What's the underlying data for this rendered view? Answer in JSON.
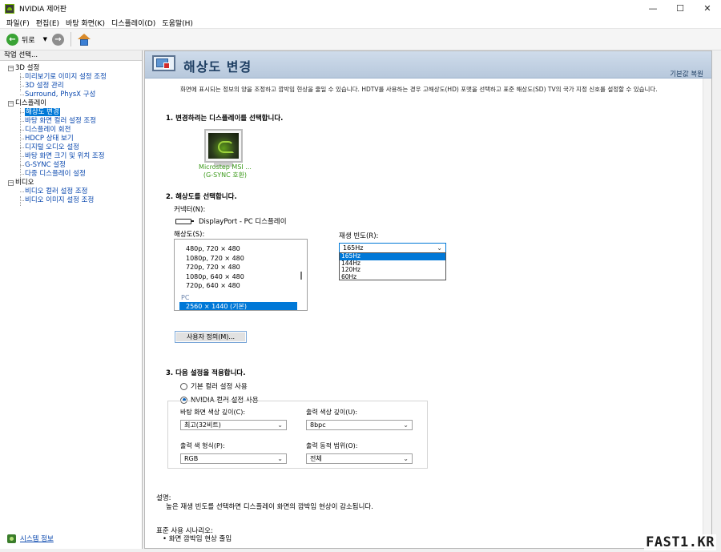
{
  "window": {
    "title": "NVIDIA 제어판",
    "controls": [
      "minimize",
      "maximize",
      "close"
    ]
  },
  "menu": [
    "파일(F)",
    "편집(E)",
    "바탕 화면(K)",
    "디스플레이(D)",
    "도움말(H)"
  ],
  "toolbar": {
    "back_label": "뒤로",
    "back_icon": "back-arrow-icon",
    "forward_icon": "forward-arrow-icon",
    "home_icon": "home-icon"
  },
  "sidebar": {
    "header": "작업 선택...",
    "categories": [
      {
        "label": "3D 설정",
        "items": [
          "미리보기로 이미지 설정 조정",
          "3D 설정 관리",
          "Surround, PhysX 구성"
        ]
      },
      {
        "label": "디스플레이",
        "items": [
          "해상도 변경",
          "바탕 화면 컬러 설정 조정",
          "디스플레이 회전",
          "HDCP 상태 보기",
          "디지털 오디오 설정",
          "바탕 화면 크기 및 위치 조정",
          "G-SYNC 설정",
          "다중 디스플레이 설정"
        ]
      },
      {
        "label": "비디오",
        "items": [
          "비디오 컬러 설정 조정",
          "비디오 이미지 설정 조정"
        ]
      }
    ],
    "selected_item": "해상도 변경",
    "system_info": "시스템 정보"
  },
  "main": {
    "title": "해상도 변경",
    "restore_defaults": "기본값 복원",
    "description": "화면에 표시되는 정보의 양을 조정하고 깜박임 현상을 줄일 수 있습니다. HDTV를 사용하는 경우 고해상도(HD) 포맷을 선택하고 표준 해상도(SD) TV의 국가 지정 신호를 설정할 수 있습니다.",
    "step1": "1. 변경하려는 디스플레이를 선택합니다.",
    "display": {
      "name": "Microstep MSI ...",
      "sub": "(G-SYNC 호환)"
    },
    "step2": "2. 해상도를 선택합니다.",
    "connector_label": "커넥터(N):",
    "connector_value": "DisplayPort - PC 디스플레이",
    "resolution_label": "해상도(S):",
    "resolutions": [
      "480p, 720 × 480",
      "1080p, 720 × 480",
      "720p, 720 × 480",
      "1080p, 640 × 480",
      "720p, 640 × 480"
    ],
    "resolution_group": "PC",
    "resolution_selected": "2560 × 1440 (기본)",
    "refresh_label": "재생 빈도(R):",
    "refresh_value": "165Hz",
    "refresh_options": [
      "165Hz",
      "144Hz",
      "120Hz",
      "60Hz"
    ],
    "customize_button": "사용자 정의(M)...",
    "step3": "3. 다음 설정을 적용합니다.",
    "radio_default": "기본 컬러 설정 사용",
    "radio_nvidia": "NVIDIA 컬러 설정 사용",
    "desktop_depth_label": "바탕 화면 색상 깊이(C):",
    "desktop_depth_value": "최고(32비트)",
    "output_depth_label": "출력 색상 깊이(U):",
    "output_depth_value": "8bpc",
    "output_format_label": "출력 색 형식(P):",
    "output_format_value": "RGB",
    "output_range_label": "출력 동적 범위(O):",
    "output_range_value": "전체",
    "about_label": "설명:",
    "about_text": "높은 재생 빈도를 선택하면 디스플레이 화면의 깜박임 현상이 감소됩니다.",
    "usage_label": "표준 사용 시나리오:",
    "usage_item": "• 화면 깜박임 현상 줄임"
  },
  "watermark": "FAST1.KR"
}
